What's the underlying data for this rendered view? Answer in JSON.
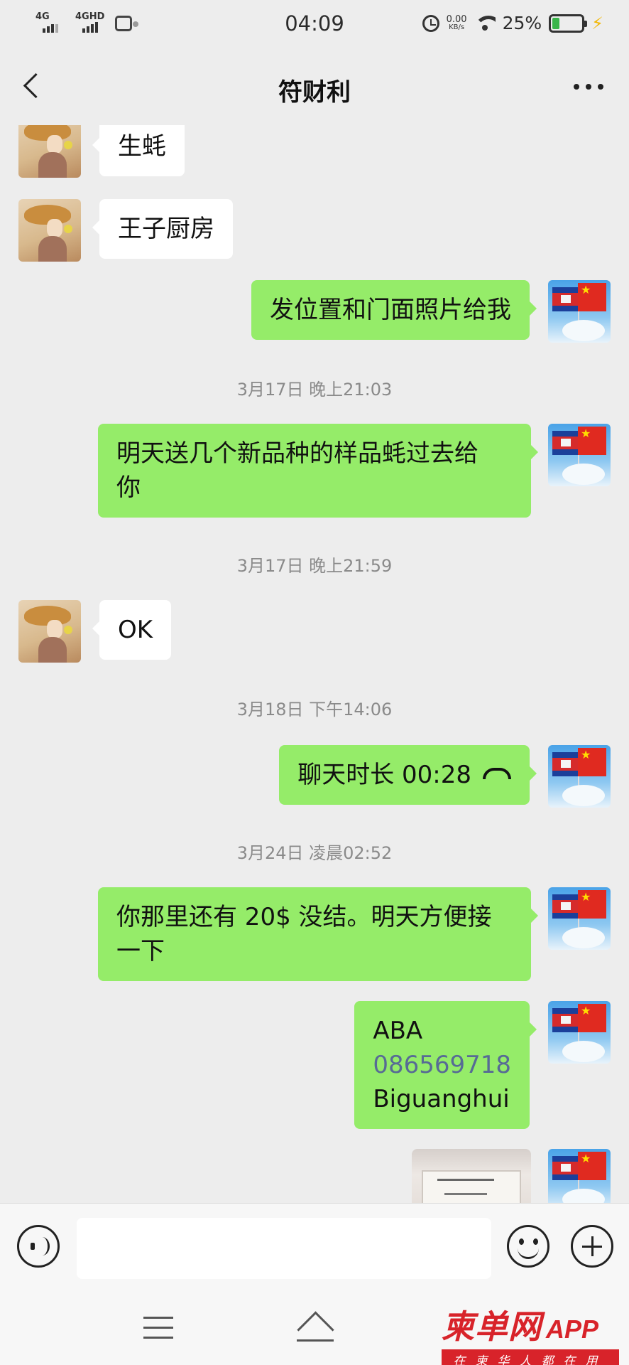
{
  "status_bar": {
    "signal1": "4G",
    "signal2": "4GHD",
    "time": "04:09",
    "net_speed_value": "0.00",
    "net_speed_unit": "KB/s",
    "battery_percent": "25%",
    "battery_level": 0.25
  },
  "header": {
    "title": "符财利"
  },
  "messages": [
    {
      "side": "left",
      "text": "生蚝"
    },
    {
      "side": "left",
      "text": "王子厨房"
    },
    {
      "side": "right",
      "text": "发位置和门面照片给我"
    },
    {
      "timestamp": "3月17日 晚上21:03"
    },
    {
      "side": "right",
      "lines": [
        "明天送几个新品种的样品蚝过去给",
        "你"
      ]
    },
    {
      "timestamp": "3月17日 晚上21:59"
    },
    {
      "side": "left",
      "text": "OK"
    },
    {
      "timestamp": "3月18日 下午14:06"
    },
    {
      "side": "right",
      "text": "聊天时长 00:28"
    },
    {
      "timestamp": "3月24日 凌晨02:52"
    },
    {
      "side": "right",
      "lines": [
        "你那里还有 20$ 没结。明天方便接",
        "一下"
      ]
    },
    {
      "side": "right",
      "lines": [
        "ABA",
        "086569718",
        "Biguanghui"
      ]
    }
  ],
  "input_bar": {
    "placeholder": ""
  },
  "watermark": {
    "brand": "柬单网",
    "app": "APP",
    "slogan": "在柬华人都在用"
  },
  "colors": {
    "background": "#ededed",
    "sent_bubble": "#95ec69",
    "received_bubble": "#ffffff",
    "link": "#576b95",
    "watermark_red": "#d8232a"
  }
}
